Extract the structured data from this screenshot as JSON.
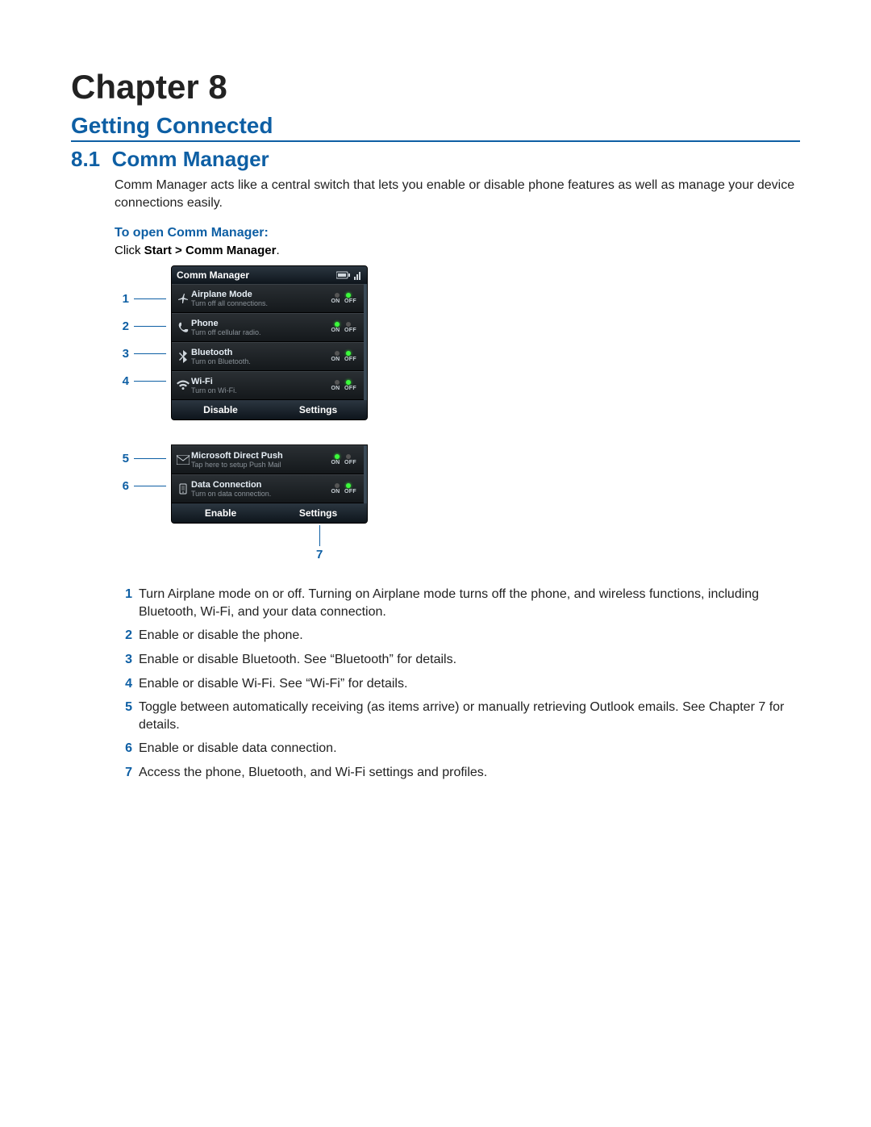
{
  "chapter_title": "Chapter 8",
  "subtitle": "Getting Connected",
  "section": {
    "num": "8.1",
    "title": "Comm Manager"
  },
  "intro": "Comm Manager acts like a central switch that lets you enable or disable phone features as well as manage your device connections easily.",
  "open_heading": "To open Comm Manager:",
  "instruction_prefix": "Click ",
  "instruction_bold": "Start > Comm Manager",
  "instruction_suffix": ".",
  "device1": {
    "title": "Comm Manager",
    "rows": [
      {
        "icon": "airplane",
        "title": "Airplane Mode",
        "sub": "Turn off all connections.",
        "on": false
      },
      {
        "icon": "phone",
        "title": "Phone",
        "sub": "Turn off cellular radio.",
        "on": true
      },
      {
        "icon": "bluetooth",
        "title": "Bluetooth",
        "sub": "Turn on Bluetooth.",
        "on": false
      },
      {
        "icon": "wifi",
        "title": "Wi-Fi",
        "sub": "Turn on Wi-Fi.",
        "on": false
      }
    ],
    "soft_left": "Disable",
    "soft_right": "Settings"
  },
  "device2": {
    "rows": [
      {
        "icon": "mail",
        "title": "Microsoft Direct Push",
        "sub": "Tap here to setup Push Mail",
        "on": true
      },
      {
        "icon": "data",
        "title": "Data Connection",
        "sub": "Turn on data connection.",
        "on": false
      }
    ],
    "soft_left": "Enable",
    "soft_right": "Settings"
  },
  "callouts1": [
    "1",
    "2",
    "3",
    "4"
  ],
  "callouts2": [
    "5",
    "6"
  ],
  "callout7": "7",
  "onoff_labels": {
    "on": "ON",
    "off": "OFF"
  },
  "list": [
    {
      "n": "1",
      "t": "Turn Airplane mode on or off. Turning on Airplane mode turns off the phone, and wireless functions, including Bluetooth, Wi-Fi, and your data connection."
    },
    {
      "n": "2",
      "t": "Enable or disable the phone."
    },
    {
      "n": "3",
      "t": "Enable or disable Bluetooth. See “Bluetooth” for details."
    },
    {
      "n": "4",
      "t": "Enable or disable Wi-Fi. See “Wi-Fi” for details."
    },
    {
      "n": "5",
      "t": "Toggle between automatically receiving (as items arrive) or manually retrieving Outlook emails. See Chapter 7 for details."
    },
    {
      "n": "6",
      "t": "Enable or disable data connection."
    },
    {
      "n": "7",
      "t": "Access the phone, Bluetooth, and Wi-Fi settings and profiles."
    }
  ]
}
